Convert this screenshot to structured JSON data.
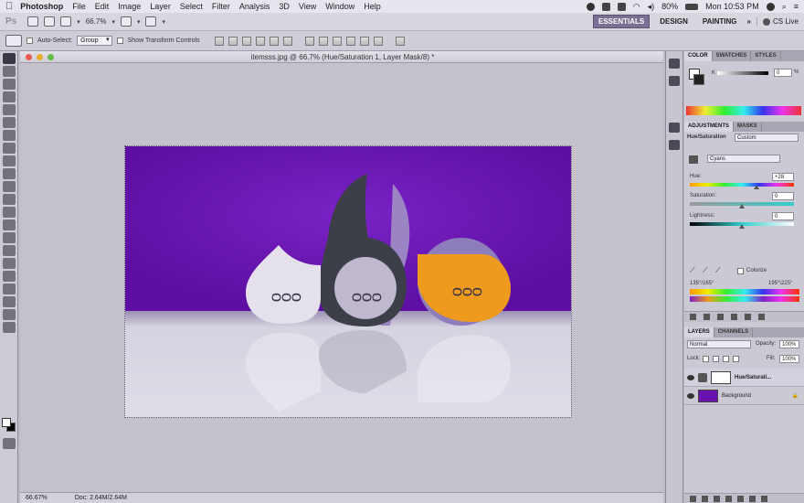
{
  "menubar": {
    "app_name": "Photoshop",
    "items": [
      "File",
      "Edit",
      "Image",
      "Layer",
      "Select",
      "Filter",
      "Analysis",
      "3D",
      "View",
      "Window",
      "Help"
    ],
    "battery": "80%",
    "clock": "Mon 10:53 PM"
  },
  "appbar": {
    "logo": "Ps",
    "zoom": "66.7%",
    "workspaces": [
      "ESSENTIALS",
      "DESIGN",
      "PAINTING"
    ],
    "more": "»",
    "cs_live": "CS Live"
  },
  "options": {
    "auto_select_label": "Auto-Select:",
    "auto_select_value": "Group",
    "transform_label": "Show Transform Controls"
  },
  "document": {
    "title": "itemsss.jpg @ 66.7% (Hue/Saturation 1, Layer Mask/8) *",
    "status_zoom": "66.67%",
    "status_doc": "Doc: 2.64M/2.64M",
    "glyph": "ᴑᴑᴑ"
  },
  "color_panel": {
    "tabs": [
      "COLOR",
      "SWATCHES",
      "STYLES"
    ],
    "channel_label": "K",
    "channel_value": "0",
    "percent": "%"
  },
  "adjustments_panel": {
    "tabs": [
      "ADJUSTMENTS",
      "MASKS"
    ],
    "title": "Hue/Saturation",
    "preset": "Custom",
    "channel": "Cyans",
    "hue_label": "Hue:",
    "hue_value": "+28",
    "saturation_label": "Saturation:",
    "saturation_value": "0",
    "lightness_label": "Lightness:",
    "lightness_value": "0",
    "colorize_label": "Colorize",
    "range_left": "135°/165°",
    "range_right": "195°\\225°"
  },
  "layers_panel": {
    "tabs": [
      "LAYERS",
      "CHANNELS"
    ],
    "blend_mode": "Normal",
    "opacity_label": "Opacity:",
    "opacity_value": "100%",
    "lock_label": "Lock:",
    "fill_label": "Fill:",
    "fill_value": "100%",
    "layers": [
      {
        "name": "Hue/Saturati..."
      },
      {
        "name": "Background"
      }
    ]
  },
  "colors": {
    "purple": "#6a12b0",
    "accent": "#7a7094",
    "orange": "#ee9a1c",
    "dark_drop": "#3c3e48"
  }
}
